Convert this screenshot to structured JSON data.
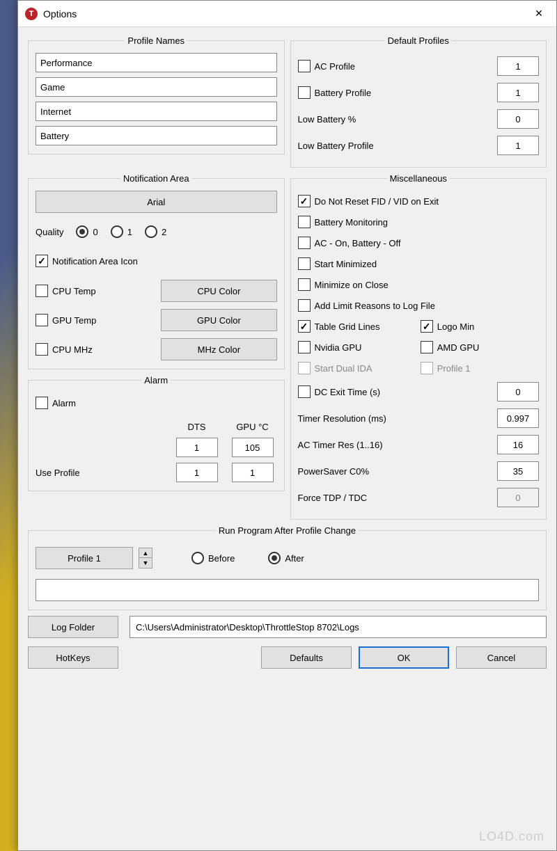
{
  "title": "Options",
  "profileNames": {
    "legend": "Profile Names",
    "items": [
      "Performance",
      "Game",
      "Internet",
      "Battery"
    ]
  },
  "defaultProfiles": {
    "legend": "Default Profiles",
    "ac": {
      "label": "AC Profile",
      "value": "1"
    },
    "battery": {
      "label": "Battery Profile",
      "value": "1"
    },
    "lowPct": {
      "label": "Low Battery %",
      "value": "0"
    },
    "lowProf": {
      "label": "Low Battery Profile",
      "value": "1"
    }
  },
  "notif": {
    "legend": "Notification Area",
    "font": "Arial",
    "qualityLabel": "Quality",
    "quality": [
      "0",
      "1",
      "2"
    ],
    "trayIcon": "Notification Area Icon",
    "cpuTemp": "CPU Temp",
    "cpuColor": "CPU Color",
    "gpuTemp": "GPU Temp",
    "gpuColor": "GPU Color",
    "cpuMhz": "CPU MHz",
    "mhzColor": "MHz Color"
  },
  "alarm": {
    "legend": "Alarm",
    "alarm": "Alarm",
    "dts": "DTS",
    "gpuC": "GPU °C",
    "row1": [
      "1",
      "105"
    ],
    "useProfile": "Use Profile",
    "row2": [
      "1",
      "1"
    ]
  },
  "misc": {
    "legend": "Miscellaneous",
    "noReset": "Do Not Reset FID / VID on Exit",
    "batMon": "Battery Monitoring",
    "acOnBatOff": "AC - On, Battery - Off",
    "startMin": "Start Minimized",
    "minClose": "Minimize on Close",
    "limitLog": "Add Limit Reasons to Log File",
    "gridLines": "Table Grid Lines",
    "logoMin": "Logo Min",
    "nvidia": "Nvidia GPU",
    "amd": "AMD GPU",
    "dualIda": "Start Dual IDA",
    "profile1": "Profile 1",
    "dcExit": {
      "label": "DC Exit Time (s)",
      "value": "0"
    },
    "timerRes": {
      "label": "Timer Resolution (ms)",
      "value": "0.997"
    },
    "acTimerRes": {
      "label": "AC Timer Res (1..16)",
      "value": "16"
    },
    "powerSaver": {
      "label": "PowerSaver C0%",
      "value": "35"
    },
    "forceTdp": {
      "label": "Force TDP / TDC",
      "value": "0"
    }
  },
  "runProg": {
    "legend": "Run Program After Profile Change",
    "profile": "Profile 1",
    "before": "Before",
    "after": "After"
  },
  "footer": {
    "logFolder": "Log Folder",
    "logPath": "C:\\Users\\Administrator\\Desktop\\ThrottleStop 8702\\Logs",
    "hotkeys": "HotKeys",
    "defaults": "Defaults",
    "ok": "OK",
    "cancel": "Cancel"
  },
  "watermark": "LO4D.com"
}
